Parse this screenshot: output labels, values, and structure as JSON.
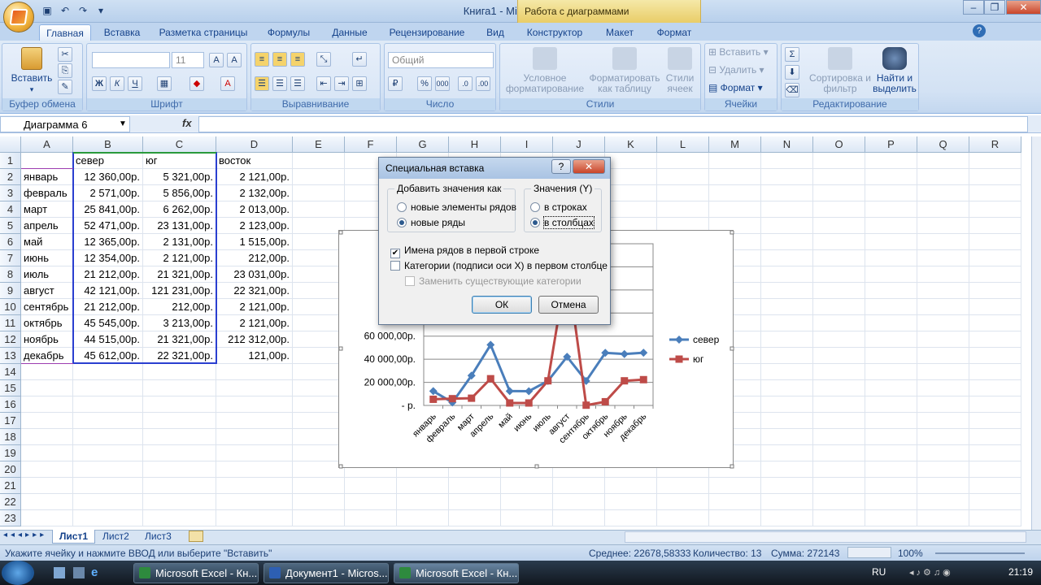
{
  "window": {
    "title": "Книга1 - Microsoft Excel",
    "context_title": "Работа с диаграммами"
  },
  "tabs": [
    "Главная",
    "Вставка",
    "Разметка страницы",
    "Формулы",
    "Данные",
    "Рецензирование",
    "Вид",
    "Конструктор",
    "Макет",
    "Формат"
  ],
  "ribbon": {
    "clipboard": {
      "label": "Буфер обмена",
      "paste": "Вставить"
    },
    "font": {
      "label": "Шрифт",
      "size": "11"
    },
    "alignment": {
      "label": "Выравнивание"
    },
    "number": {
      "label": "Число",
      "format": "Общий"
    },
    "styles": {
      "label": "Стили",
      "cond_format": "Условное форматирование",
      "format_table": "Форматировать как таблицу",
      "cell_styles": "Стили ячеек"
    },
    "cells": {
      "label": "Ячейки",
      "insert": "Вставить",
      "delete": "Удалить",
      "format": "Формат"
    },
    "editing": {
      "label": "Редактирование",
      "sort": "Сортировка и фильтр",
      "find": "Найти и выделить"
    }
  },
  "formula_bar": {
    "name_box": "Диаграмма 6",
    "fx": "fx",
    "value": ""
  },
  "columns": [
    "A",
    "B",
    "C",
    "D",
    "E",
    "F",
    "G",
    "H",
    "I",
    "J",
    "K",
    "L",
    "M",
    "N",
    "O",
    "P",
    "Q",
    "R"
  ],
  "rows": [
    "1",
    "2",
    "3",
    "4",
    "5",
    "6",
    "7",
    "8",
    "9",
    "10",
    "11",
    "12",
    "13",
    "14",
    "15",
    "16",
    "17",
    "18",
    "19",
    "20",
    "21",
    "22",
    "23"
  ],
  "sheet": {
    "header": [
      "",
      "север",
      "юг",
      "восток"
    ],
    "data": [
      [
        "январь",
        "12 360,00р.",
        "5 321,00р.",
        "2 121,00р."
      ],
      [
        "февраль",
        "2 571,00р.",
        "5 856,00р.",
        "2 132,00р."
      ],
      [
        "март",
        "25 841,00р.",
        "6 262,00р.",
        "2 013,00р."
      ],
      [
        "апрель",
        "52 471,00р.",
        "23 131,00р.",
        "2 123,00р."
      ],
      [
        "май",
        "12 365,00р.",
        "2 131,00р.",
        "1 515,00р."
      ],
      [
        "июнь",
        "12 354,00р.",
        "2 121,00р.",
        "212,00р."
      ],
      [
        "июль",
        "21 212,00р.",
        "21 321,00р.",
        "23 031,00р."
      ],
      [
        "август",
        "42 121,00р.",
        "121 231,00р.",
        "22 321,00р."
      ],
      [
        "сентябрь",
        "21 212,00р.",
        "212,00р.",
        "2 121,00р."
      ],
      [
        "октябрь",
        "45 545,00р.",
        "3 213,00р.",
        "2 121,00р."
      ],
      [
        "ноябрь",
        "44 515,00р.",
        "21 321,00р.",
        "212 312,00р."
      ],
      [
        "декабрь",
        "45 612,00р.",
        "22 321,00р.",
        "121,00р."
      ]
    ]
  },
  "chart_data": {
    "type": "line",
    "categories": [
      "январь",
      "февраль",
      "март",
      "апрель",
      "май",
      "июнь",
      "июль",
      "август",
      "сентябрь",
      "октябрь",
      "ноябрь",
      "декабрь"
    ],
    "series": [
      {
        "name": "север",
        "color": "#4a7ebb",
        "values": [
          12360,
          2571,
          25841,
          52471,
          12365,
          12354,
          21212,
          42121,
          21212,
          45545,
          44515,
          45612
        ]
      },
      {
        "name": "юг",
        "color": "#be4b48",
        "values": [
          5321,
          5856,
          6262,
          23131,
          2131,
          2121,
          21321,
          121231,
          212,
          3213,
          21321,
          22321
        ]
      }
    ],
    "yticks": [
      "-  р.",
      "20 000,00р.",
      "40 000,00р.",
      "60 000,00р.",
      "80 0",
      "100 0",
      "120 0",
      "140 0"
    ],
    "ylim": [
      0,
      140000
    ],
    "legend": "right"
  },
  "dialog": {
    "title": "Специальная вставка",
    "help": "?",
    "close": "✕",
    "add_as": {
      "legend": "Добавить значения как",
      "opt1": "новые элементы рядов",
      "opt2": "новые ряды"
    },
    "values_y": {
      "legend": "Значения (Y)",
      "opt1": "в строках",
      "opt2": "в столбцах"
    },
    "chk_names": "Имена рядов в первой строке",
    "chk_cats": "Категории (подписи оси X) в первом столбце",
    "chk_replace": "Заменить существующие категории",
    "ok": "ОК",
    "cancel": "Отмена"
  },
  "sheets": [
    "Лист1",
    "Лист2",
    "Лист3"
  ],
  "status": {
    "hint": "Укажите ячейку и нажмите ВВОД или выберите \"Вставить\"",
    "avg": "Среднее: 22678,58333",
    "count": "Количество: 13",
    "sum": "Сумма: 272143",
    "zoom": "100%"
  },
  "taskbar": {
    "items": [
      "Microsoft Excel - Кн...",
      "Документ1 - Micros...",
      "Microsoft Excel - Кн..."
    ],
    "lang": "RU",
    "time": "21:19"
  }
}
